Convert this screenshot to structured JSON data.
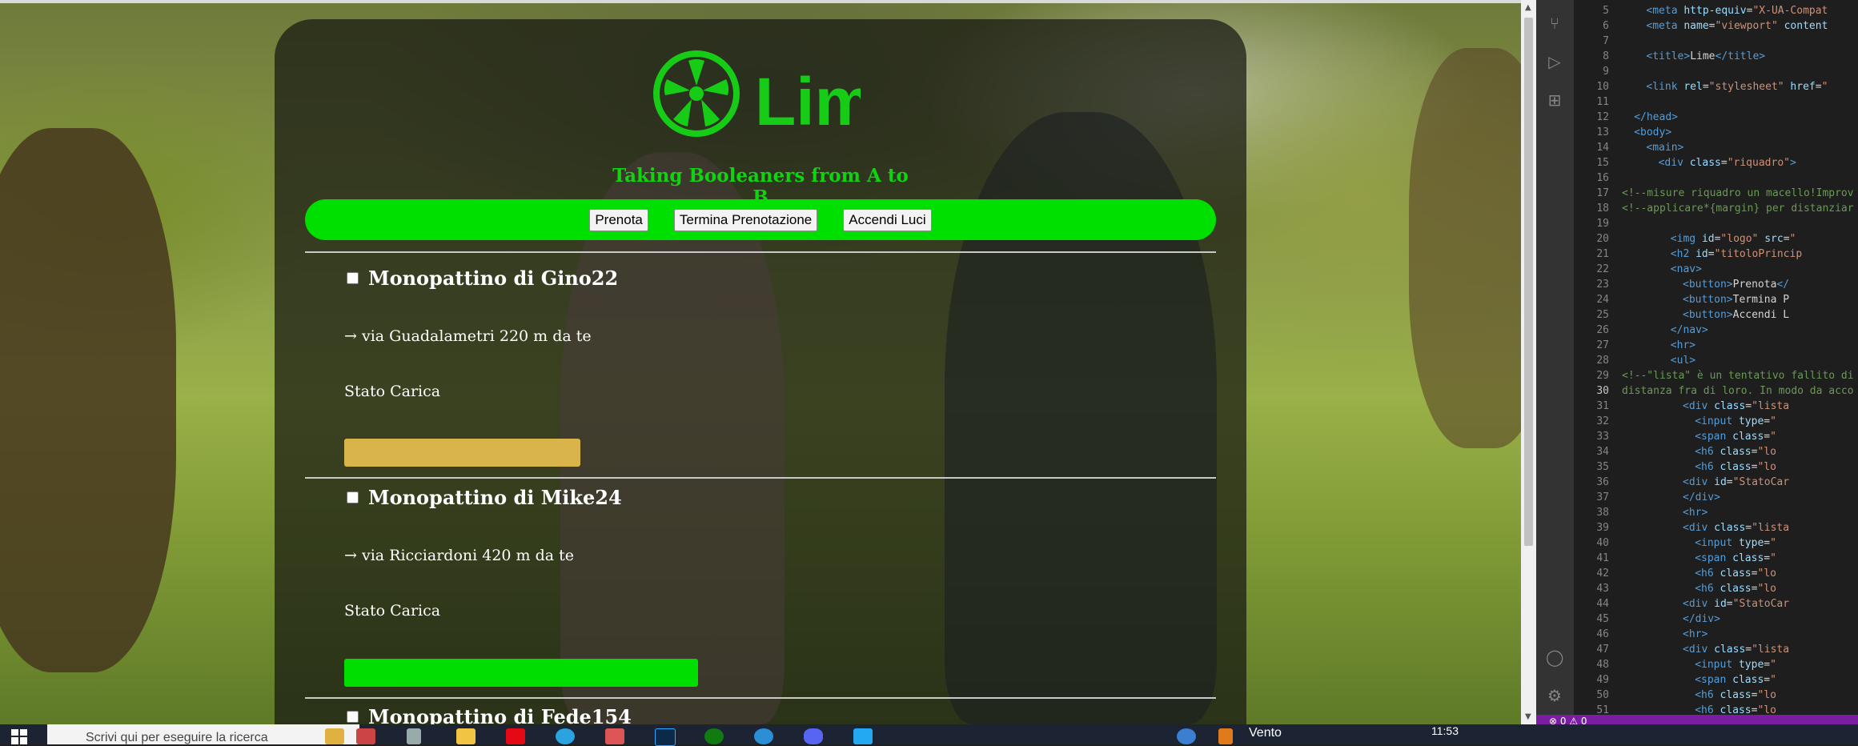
{
  "app": {
    "subtitle": "Taking Booleaners from A to B",
    "logo_text": "Lim",
    "nav": [
      "Prenota",
      "Termina Prenotazione",
      "Accendi Luci"
    ],
    "items": [
      {
        "title": "Monopattino di Gino22",
        "distance": "→ via Guadalametri 220 m da te",
        "stato": "Stato Carica",
        "charge_pct": 44,
        "bar_color": "#d9b44a"
      },
      {
        "title": "Monopattino di Mike24",
        "distance": "→ via Ricciardoni 420 m da te",
        "stato": "Stato Carica",
        "charge_pct": 66,
        "bar_color": "#00dd00"
      },
      {
        "title": "Monopattino di Fede154"
      }
    ],
    "colors": {
      "accent": "#00e000",
      "logo": "#16cc16"
    }
  },
  "editor": {
    "lines": [
      {
        "n": "5",
        "html": "<span class='tag'>&lt;meta</span> <span class='attr'>http-equiv</span>=<span class='str'>\"X-UA-Compat</span>"
      },
      {
        "n": "6",
        "html": "<span class='tag'>&lt;meta</span> <span class='attr'>name</span>=<span class='str'>\"viewport\"</span> <span class='attr'>content</span>"
      },
      {
        "n": "7",
        "html": ""
      },
      {
        "n": "8",
        "html": "<span class='tag'>&lt;title&gt;</span>Lime<span class='tag'>&lt;/title&gt;</span>"
      },
      {
        "n": "9",
        "html": ""
      },
      {
        "n": "10",
        "html": "<span class='tag'>&lt;link</span> <span class='attr'>rel</span>=<span class='str'>\"stylesheet\"</span> <span class='attr'>href</span>=<span class='str'>\"</span>"
      },
      {
        "n": "11",
        "html": ""
      },
      {
        "n": "12",
        "html": "<span class='tag'>&lt;/head&gt;</span>"
      },
      {
        "n": "13",
        "html": "<span class='tag'>&lt;body&gt;</span>"
      },
      {
        "n": "14",
        "html": "<span class='tag'>&lt;main&gt;</span>"
      },
      {
        "n": "15",
        "html": "<span class='tag'>&lt;div</span> <span class='attr'>class</span>=<span class='str'>\"riquadro\"</span><span class='tag'>&gt;</span>"
      },
      {
        "n": "16",
        "html": ""
      },
      {
        "n": "17",
        "html": "<span class='cmt'>&lt;!--misure riquadro un macello!Improv</span>"
      },
      {
        "n": "18",
        "html": "<span class='cmt'>&lt;!--applicare*{margin} per distanziar</span>"
      },
      {
        "n": "19",
        "html": ""
      },
      {
        "n": "20",
        "html": "<span class='tag'>&lt;img</span> <span class='attr'>id</span>=<span class='str'>\"logo\"</span> <span class='attr'>src</span>=<span class='str'>\"</span>"
      },
      {
        "n": "21",
        "html": "<span class='tag'>&lt;h2</span> <span class='attr'>id</span>=<span class='str'>\"titoloPrincip</span>"
      },
      {
        "n": "22",
        "html": "<span class='tag'>&lt;nav&gt;</span>"
      },
      {
        "n": "23",
        "html": "<span class='tag'>&lt;button&gt;</span>Prenota<span class='tag'>&lt;/</span>"
      },
      {
        "n": "24",
        "html": "<span class='tag'>&lt;button&gt;</span>Termina P"
      },
      {
        "n": "25",
        "html": "<span class='tag'>&lt;button&gt;</span>Accendi L"
      },
      {
        "n": "26",
        "html": "<span class='tag'>&lt;/nav&gt;</span>"
      },
      {
        "n": "27",
        "html": "<span class='tag'>&lt;hr&gt;</span>"
      },
      {
        "n": "28",
        "html": "<span class='tag'>&lt;ul&gt;</span>"
      },
      {
        "n": "29",
        "html": "<span class='cmt'>&lt;!--\"lista\" è un tentativo fallito di</span>"
      },
      {
        "n": "30",
        "html": "<span class='cmt'>distanza fra di loro. In modo da acco</span>"
      },
      {
        "n": "31",
        "html": "<span class='tag'>&lt;div</span> <span class='attr'>class</span>=<span class='str'>\"lista</span>"
      },
      {
        "n": "32",
        "html": "<span class='tag'>&lt;input</span> <span class='attr'>type</span>=<span class='str'>\"</span>"
      },
      {
        "n": "33",
        "html": "<span class='tag'>&lt;span</span> <span class='attr'>class</span>=<span class='str'>\"</span>"
      },
      {
        "n": "34",
        "html": "<span class='tag'>&lt;h6</span> <span class='attr'>class</span>=<span class='str'>\"lo</span>"
      },
      {
        "n": "35",
        "html": "<span class='tag'>&lt;h6</span> <span class='attr'>class</span>=<span class='str'>\"lo</span>"
      },
      {
        "n": "36",
        "html": "<span class='tag'>&lt;div</span> <span class='attr'>id</span>=<span class='str'>\"StatoCar</span>"
      },
      {
        "n": "37",
        "html": "<span class='tag'>&lt;/div&gt;</span>"
      },
      {
        "n": "38",
        "html": "<span class='tag'>&lt;hr&gt;</span>"
      },
      {
        "n": "39",
        "html": "<span class='tag'>&lt;div</span> <span class='attr'>class</span>=<span class='str'>\"lista</span>"
      },
      {
        "n": "40",
        "html": "<span class='tag'>&lt;input</span> <span class='attr'>type</span>=<span class='str'>\"</span>"
      },
      {
        "n": "41",
        "html": "<span class='tag'>&lt;span</span> <span class='attr'>class</span>=<span class='str'>\"</span>"
      },
      {
        "n": "42",
        "html": "<span class='tag'>&lt;h6</span> <span class='attr'>class</span>=<span class='str'>\"lo</span>"
      },
      {
        "n": "43",
        "html": "<span class='tag'>&lt;h6</span> <span class='attr'>class</span>=<span class='str'>\"lo</span>"
      },
      {
        "n": "44",
        "html": "<span class='tag'>&lt;div</span> <span class='attr'>id</span>=<span class='str'>\"StatoCar</span>"
      },
      {
        "n": "45",
        "html": "<span class='tag'>&lt;/div&gt;</span>"
      },
      {
        "n": "46",
        "html": "<span class='tag'>&lt;hr&gt;</span>"
      },
      {
        "n": "47",
        "html": "<span class='tag'>&lt;div</span> <span class='attr'>class</span>=<span class='str'>\"lista</span>"
      },
      {
        "n": "48",
        "html": "<span class='tag'>&lt;input</span> <span class='attr'>type</span>=<span class='str'>\"</span>"
      },
      {
        "n": "49",
        "html": "<span class='tag'>&lt;span</span> <span class='attr'>class</span>=<span class='str'>\"</span>"
      },
      {
        "n": "50",
        "html": "<span class='tag'>&lt;h6</span> <span class='attr'>class</span>=<span class='str'>\"lo</span>"
      },
      {
        "n": "51",
        "html": "<span class='tag'>&lt;h6</span> <span class='attr'>class</span>=<span class='str'>\"lo</span>"
      }
    ],
    "status": "⊗ 0 ⚠ 0"
  },
  "taskbar": {
    "search_placeholder": "Scrivi qui per eseguire la ricerca",
    "weather": "Vento",
    "clock": "11:53"
  }
}
